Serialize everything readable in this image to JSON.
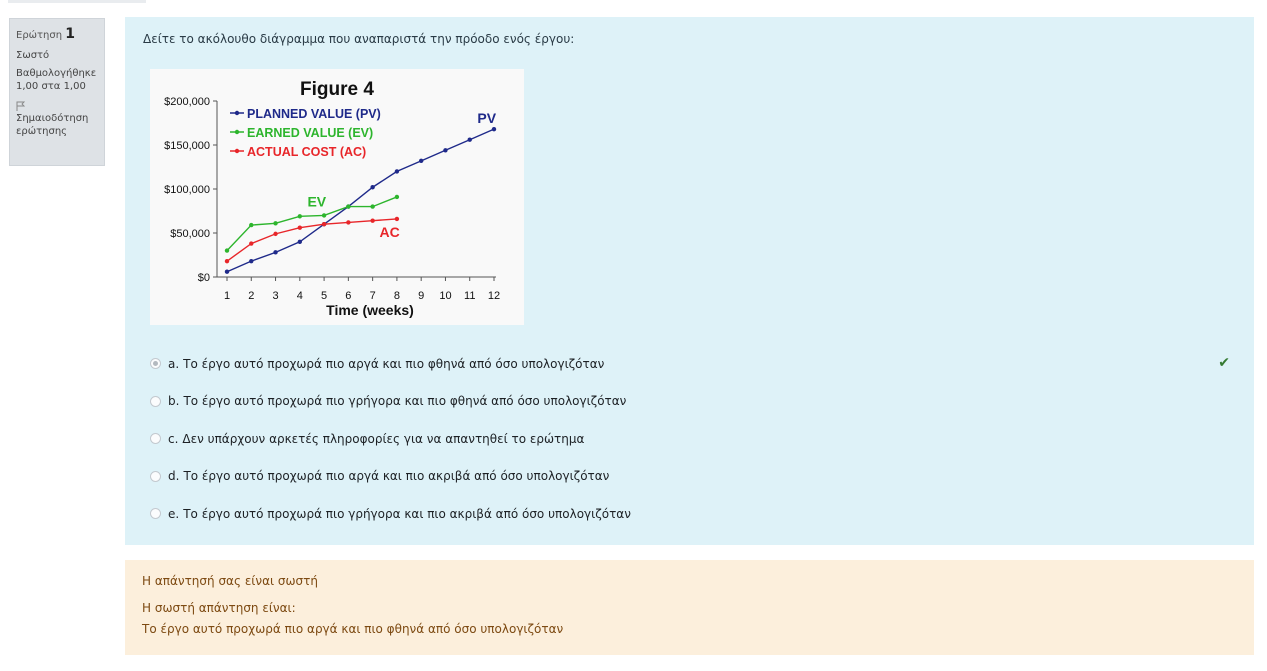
{
  "info": {
    "question_label": "Ερώτηση",
    "question_number": "1",
    "state": "Σωστό",
    "grade": "Βαθμολογήθηκε 1,00 στα 1,00",
    "flag_label": "Σημαιοδότηση ερώτησης"
  },
  "question": {
    "text": "Δείτε το ακόλουθο διάγραμμα που αναπαριστά την πρόοδο ενός έργου:",
    "answers": [
      {
        "letter": "a.",
        "text": "Το έργο αυτό προχωρά πιο αργά και πιο φθηνά από όσο υπολογιζόταν",
        "checked": true,
        "correct": true
      },
      {
        "letter": "b.",
        "text": "Το έργο αυτό προχωρά πιο γρήγορα και πιο φθηνά από όσο υπολογιζόταν",
        "checked": false
      },
      {
        "letter": "c.",
        "text": "Δεν υπάρχουν αρκετές πληροφορίες για να απαντηθεί το ερώτημα",
        "checked": false
      },
      {
        "letter": "d.",
        "text": "Το έργο αυτό προχωρά πιο αργά και πιο ακριβά από όσο υπολογιζόταν",
        "checked": false
      },
      {
        "letter": "e.",
        "text": "Το έργο αυτό προχωρά πιο γρήγορα και πιο ακριβά από όσο υπολογιζόταν",
        "checked": false
      }
    ]
  },
  "outcome": {
    "feedback": "Η απάντησή σας είναι σωστή",
    "right_answer_label": "Η σωστή απάντηση είναι:",
    "right_answer": "Το έργο αυτό προχωρά πιο αργά και πιο φθηνά από όσο υπολογιζόταν"
  },
  "colors": {
    "planned": "#1f2a8a",
    "earned": "#2db52d",
    "actual": "#e8262a",
    "correct_check": "#357a32"
  },
  "chart_data": {
    "type": "line",
    "title": "Figure 4",
    "xlabel": "Time (weeks)",
    "ylabel": "",
    "x": [
      1,
      2,
      3,
      4,
      5,
      6,
      7,
      8,
      9,
      10,
      11,
      12
    ],
    "y_ticks": [
      "$0",
      "$50,000",
      "$100,000",
      "$150,000",
      "$200,000"
    ],
    "ylim": [
      0,
      200000
    ],
    "legend_position": "top-left",
    "series": [
      {
        "name": "PLANNED VALUE (PV)",
        "label": "PV",
        "color": "#1f2a8a",
        "x": [
          1,
          2,
          3,
          4,
          5,
          6,
          7,
          8,
          9,
          10,
          11,
          12
        ],
        "values": [
          6000,
          18000,
          28000,
          40000,
          60000,
          80000,
          102000,
          120000,
          132000,
          144000,
          156000,
          168000
        ]
      },
      {
        "name": "EARNED VALUE (EV)",
        "label": "EV",
        "color": "#2db52d",
        "x": [
          1,
          2,
          3,
          4,
          5,
          6,
          7,
          8
        ],
        "values": [
          30000,
          59000,
          61000,
          69000,
          70000,
          80000,
          80000,
          91000
        ]
      },
      {
        "name": "ACTUAL COST (AC)",
        "label": "AC",
        "color": "#e8262a",
        "x": [
          1,
          2,
          3,
          4,
          5,
          6,
          7,
          8
        ],
        "values": [
          18000,
          38000,
          49000,
          56000,
          60000,
          62000,
          64000,
          66000
        ]
      }
    ]
  }
}
